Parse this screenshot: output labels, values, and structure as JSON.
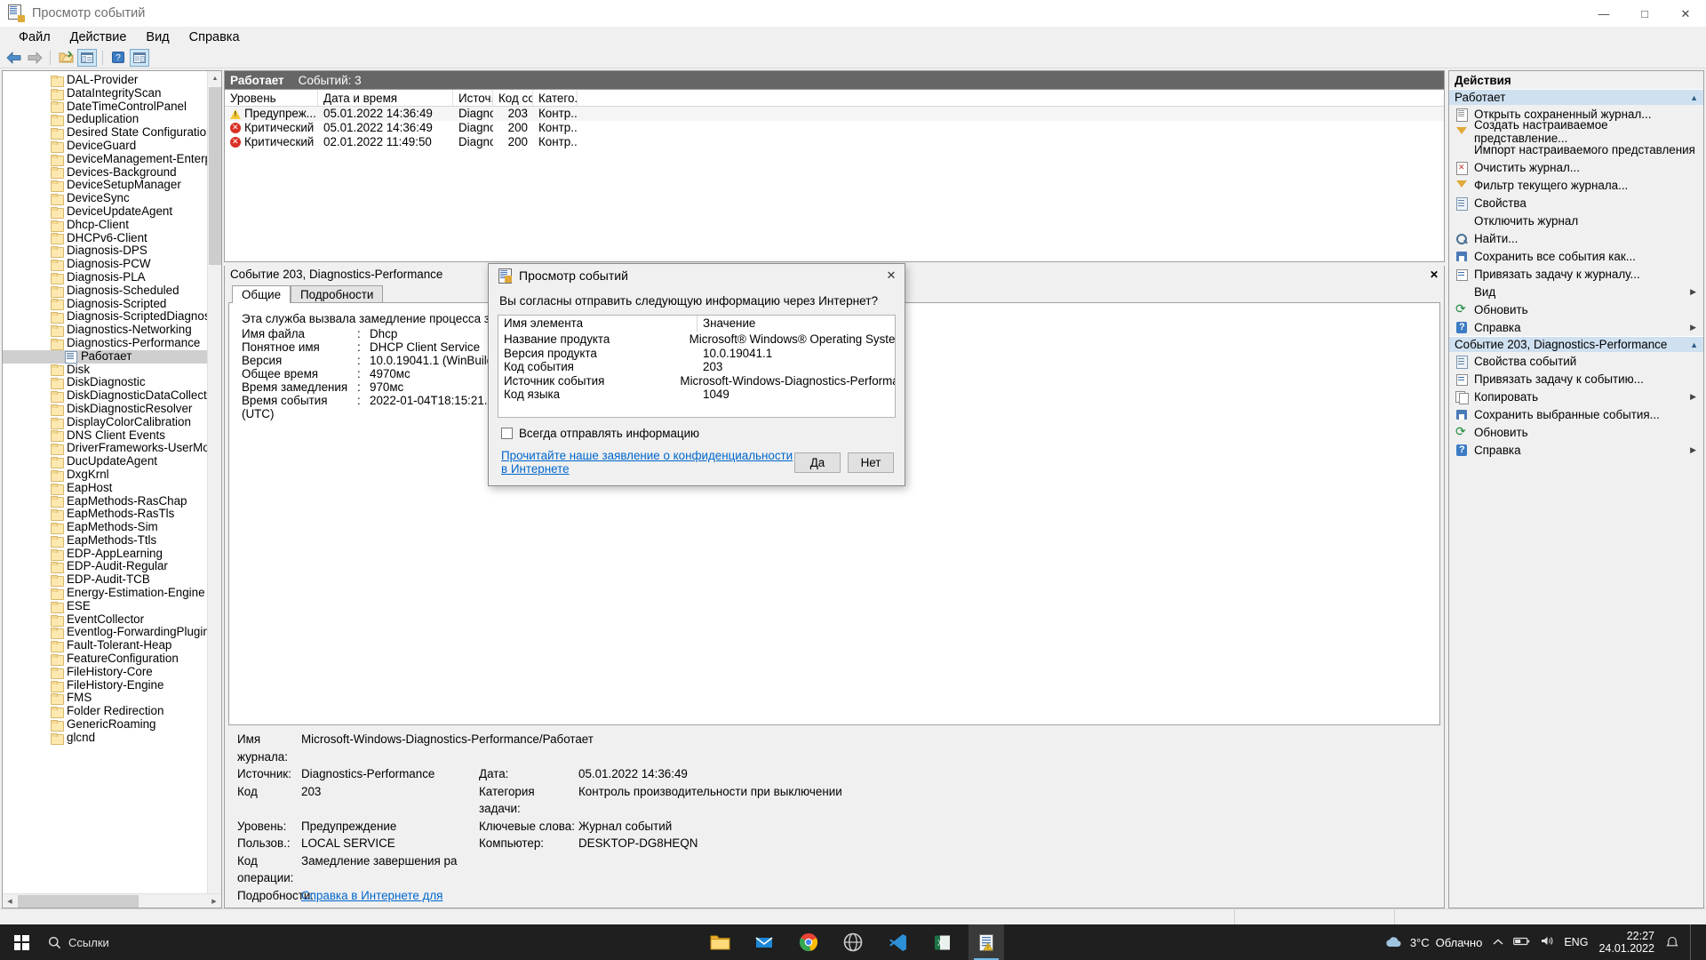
{
  "window": {
    "title": "Просмотр событий",
    "icon": "event-viewer-icon",
    "minimize": "—",
    "maximize": "□",
    "close": "✕"
  },
  "menu": [
    "Файл",
    "Действие",
    "Вид",
    "Справка"
  ],
  "toolbar": [
    {
      "name": "back-icon",
      "glyph": "⬅"
    },
    {
      "name": "forward-icon",
      "glyph": "➡"
    },
    {
      "name": "open-folder-icon",
      "glyph": "📂"
    },
    {
      "name": "show-hide-tree-icon",
      "glyph": "▤"
    },
    {
      "name": "help-icon",
      "glyph": "?"
    },
    {
      "name": "show-action-pane-icon",
      "glyph": "▥"
    }
  ],
  "tree": {
    "items": [
      {
        "label": "DAL-Provider",
        "level": 1,
        "type": "folder",
        "expandable": true
      },
      {
        "label": "DataIntegrityScan",
        "level": 1,
        "type": "folder",
        "expandable": true
      },
      {
        "label": "DateTimeControlPanel",
        "level": 1,
        "type": "folder",
        "expandable": true
      },
      {
        "label": "Deduplication",
        "level": 1,
        "type": "folder",
        "expandable": true
      },
      {
        "label": "Desired State Configuration",
        "level": 1,
        "type": "folder",
        "expandable": true
      },
      {
        "label": "DeviceGuard",
        "level": 1,
        "type": "folder",
        "expandable": true
      },
      {
        "label": "DeviceManagement-Enterprise-D",
        "level": 1,
        "type": "folder",
        "expandable": true
      },
      {
        "label": "Devices-Background",
        "level": 1,
        "type": "folder",
        "expandable": true
      },
      {
        "label": "DeviceSetupManager",
        "level": 1,
        "type": "folder",
        "expandable": true
      },
      {
        "label": "DeviceSync",
        "level": 1,
        "type": "folder",
        "expandable": true
      },
      {
        "label": "DeviceUpdateAgent",
        "level": 1,
        "type": "folder",
        "expandable": true
      },
      {
        "label": "Dhcp-Client",
        "level": 1,
        "type": "folder",
        "expandable": true
      },
      {
        "label": "DHCPv6-Client",
        "level": 1,
        "type": "folder",
        "expandable": true
      },
      {
        "label": "Diagnosis-DPS",
        "level": 1,
        "type": "folder",
        "expandable": true
      },
      {
        "label": "Diagnosis-PCW",
        "level": 1,
        "type": "folder",
        "expandable": true
      },
      {
        "label": "Diagnosis-PLA",
        "level": 1,
        "type": "folder",
        "expandable": true
      },
      {
        "label": "Diagnosis-Scheduled",
        "level": 1,
        "type": "folder",
        "expandable": true
      },
      {
        "label": "Diagnosis-Scripted",
        "level": 1,
        "type": "folder",
        "expandable": true
      },
      {
        "label": "Diagnosis-ScriptedDiagnosticsPro",
        "level": 1,
        "type": "folder",
        "expandable": true
      },
      {
        "label": "Diagnostics-Networking",
        "level": 1,
        "type": "folder",
        "expandable": true
      },
      {
        "label": "Diagnostics-Performance",
        "level": 1,
        "type": "folder",
        "expandable": true,
        "expanded": true
      },
      {
        "label": "Работает",
        "level": 2,
        "type": "log",
        "selected": true
      },
      {
        "label": "Disk",
        "level": 1,
        "type": "folder",
        "expandable": true
      },
      {
        "label": "DiskDiagnostic",
        "level": 1,
        "type": "folder",
        "expandable": true
      },
      {
        "label": "DiskDiagnosticDataCollector",
        "level": 1,
        "type": "folder",
        "expandable": true
      },
      {
        "label": "DiskDiagnosticResolver",
        "level": 1,
        "type": "folder",
        "expandable": true
      },
      {
        "label": "DisplayColorCalibration",
        "level": 1,
        "type": "folder",
        "expandable": true
      },
      {
        "label": "DNS Client Events",
        "level": 1,
        "type": "folder",
        "expandable": true
      },
      {
        "label": "DriverFrameworks-UserMode",
        "level": 1,
        "type": "folder",
        "expandable": true
      },
      {
        "label": "DucUpdateAgent",
        "level": 1,
        "type": "folder",
        "expandable": true
      },
      {
        "label": "DxgKrnl",
        "level": 1,
        "type": "folder",
        "expandable": true
      },
      {
        "label": "EapHost",
        "level": 1,
        "type": "folder",
        "expandable": true
      },
      {
        "label": "EapMethods-RasChap",
        "level": 1,
        "type": "folder",
        "expandable": true
      },
      {
        "label": "EapMethods-RasTls",
        "level": 1,
        "type": "folder",
        "expandable": true
      },
      {
        "label": "EapMethods-Sim",
        "level": 1,
        "type": "folder",
        "expandable": true
      },
      {
        "label": "EapMethods-Ttls",
        "level": 1,
        "type": "folder",
        "expandable": true
      },
      {
        "label": "EDP-AppLearning",
        "level": 1,
        "type": "folder",
        "expandable": true
      },
      {
        "label": "EDP-Audit-Regular",
        "level": 1,
        "type": "folder",
        "expandable": true
      },
      {
        "label": "EDP-Audit-TCB",
        "level": 1,
        "type": "folder",
        "expandable": true
      },
      {
        "label": "Energy-Estimation-Engine",
        "level": 1,
        "type": "folder",
        "expandable": true
      },
      {
        "label": "ESE",
        "level": 1,
        "type": "folder",
        "expandable": true
      },
      {
        "label": "EventCollector",
        "level": 1,
        "type": "folder",
        "expandable": true
      },
      {
        "label": "Eventlog-ForwardingPlugin",
        "level": 1,
        "type": "folder",
        "expandable": true
      },
      {
        "label": "Fault-Tolerant-Heap",
        "level": 1,
        "type": "folder",
        "expandable": true
      },
      {
        "label": "FeatureConfiguration",
        "level": 1,
        "type": "folder",
        "expandable": true
      },
      {
        "label": "FileHistory-Core",
        "level": 1,
        "type": "folder",
        "expandable": true
      },
      {
        "label": "FileHistory-Engine",
        "level": 1,
        "type": "folder",
        "expandable": true
      },
      {
        "label": "FMS",
        "level": 1,
        "type": "folder",
        "expandable": true
      },
      {
        "label": "Folder Redirection",
        "level": 1,
        "type": "folder",
        "expandable": true
      },
      {
        "label": "GenericRoaming",
        "level": 1,
        "type": "folder",
        "expandable": true
      },
      {
        "label": "glcnd",
        "level": 1,
        "type": "folder",
        "expandable": true
      }
    ]
  },
  "event_list": {
    "header_title": "Работает",
    "header_count": "Событий: 3",
    "columns": [
      "Уровень",
      "Дата и время",
      "Источ...",
      "Код со...",
      "Катего..."
    ],
    "rows": [
      {
        "level": "Предупреж...",
        "level_icon": "warning-icon",
        "datetime": "05.01.2022 14:36:49",
        "source": "Diagno...",
        "event_id": "203",
        "category": "Контр..."
      },
      {
        "level": "Критический",
        "level_icon": "critical-icon",
        "datetime": "05.01.2022 14:36:49",
        "source": "Diagno...",
        "event_id": "200",
        "category": "Контр..."
      },
      {
        "level": "Критический",
        "level_icon": "critical-icon",
        "datetime": "02.01.2022 11:49:50",
        "source": "Diagno...",
        "event_id": "200",
        "category": "Контр..."
      }
    ]
  },
  "detail": {
    "title": "Событие 203, Diagnostics-Performance",
    "tabs": [
      {
        "label": "Общие",
        "active": true
      },
      {
        "label": "Подробности",
        "active": false
      }
    ],
    "message": "Эта служба вызвала замедление процесса завершения работ",
    "fields": [
      {
        "key": "Имя файла",
        "sep": ":",
        "value": "Dhcp"
      },
      {
        "key": "Понятное имя",
        "sep": ":",
        "value": "DHCP Client Service"
      },
      {
        "key": "Версия",
        "sep": ":",
        "value": "10.0.19041.1 (WinBuild.1601"
      },
      {
        "key": "Общее время",
        "sep": ":",
        "value": "4970мс"
      },
      {
        "key": "Время замедления",
        "sep": ":",
        "value": "970мс"
      },
      {
        "key": "Время события (UTC)",
        "sep": ":",
        "value": "2022-01-04T18:15:21.601857"
      }
    ],
    "footer": [
      {
        "l1": "Имя журнала:",
        "v1": "Microsoft-Windows-Diagnostics-Performance/Работает",
        "l2": "",
        "v2": ""
      },
      {
        "l1": "Источник:",
        "v1": "Diagnostics-Performance",
        "l2": "Дата:",
        "v2": "05.01.2022 14:36:49"
      },
      {
        "l1": "Код",
        "v1": "203",
        "l2": "Категория задачи:",
        "v2": "Контроль производительности при выключении"
      },
      {
        "l1": "Уровень:",
        "v1": "Предупреждение",
        "l2": "Ключевые слова:",
        "v2": "Журнал событий"
      },
      {
        "l1": "Пользов.:",
        "v1": "LOCAL SERVICE",
        "l2": "Компьютер:",
        "v2": "DESKTOP-DG8HEQN"
      },
      {
        "l1": "Код операции:",
        "v1": "Замедление завершения ра",
        "l2": "",
        "v2": ""
      },
      {
        "l1": "Подробности:",
        "v1": "Справка в Интернете для",
        "l2": "",
        "v2": "",
        "link": true
      }
    ],
    "close_label": "✕"
  },
  "actions": {
    "title": "Действия",
    "groups": [
      {
        "label": "Работает",
        "items": [
          {
            "label": "Открыть сохраненный журнал...",
            "icon": "open-log-icon",
            "submenu": false
          },
          {
            "label": "Создать настраиваемое представление...",
            "icon": "filter-icon",
            "submenu": false
          },
          {
            "label": "Импорт настраиваемого представления",
            "icon": "blank-icon",
            "submenu": false
          },
          {
            "label": "Очистить журнал...",
            "icon": "clear-log-icon",
            "submenu": false
          },
          {
            "label": "Фильтр текущего журнала...",
            "icon": "filter-icon",
            "submenu": false
          },
          {
            "label": "Свойства",
            "icon": "properties-icon",
            "submenu": false
          },
          {
            "label": "Отключить журнал",
            "icon": "blank-icon",
            "submenu": false
          },
          {
            "label": "Найти...",
            "icon": "find-icon",
            "submenu": false
          },
          {
            "label": "Сохранить все события как...",
            "icon": "save-icon",
            "submenu": false
          },
          {
            "label": "Привязать задачу к журналу...",
            "icon": "task-icon",
            "submenu": false
          },
          {
            "label": "Вид",
            "icon": "blank-icon",
            "submenu": true
          },
          {
            "label": "Обновить",
            "icon": "refresh-icon",
            "submenu": false
          },
          {
            "label": "Справка",
            "icon": "help-icon",
            "submenu": true
          }
        ]
      },
      {
        "label": "Событие 203, Diagnostics-Performance",
        "items": [
          {
            "label": "Свойства событий",
            "icon": "properties-icon",
            "submenu": false
          },
          {
            "label": "Привязать задачу к событию...",
            "icon": "task-icon",
            "submenu": false
          },
          {
            "label": "Копировать",
            "icon": "copy-icon",
            "submenu": true
          },
          {
            "label": "Сохранить выбранные события...",
            "icon": "save-icon",
            "submenu": false
          },
          {
            "label": "Обновить",
            "icon": "refresh-icon",
            "submenu": false
          },
          {
            "label": "Справка",
            "icon": "help-icon",
            "submenu": true
          }
        ]
      }
    ]
  },
  "dialog": {
    "title": "Просмотр событий",
    "icon": "event-viewer-icon",
    "close": "✕",
    "question": "Вы согласны отправить следующую информацию через Интернет?",
    "table": {
      "columns": [
        "Имя элемента",
        "Значение"
      ],
      "rows": [
        {
          "name": "Название продукта",
          "value": "Microsoft® Windows® Operating System"
        },
        {
          "name": "Версия продукта",
          "value": "10.0.19041.1"
        },
        {
          "name": "Код события",
          "value": "203"
        },
        {
          "name": "Источник события",
          "value": "Microsoft-Windows-Diagnostics-Performance"
        },
        {
          "name": "Код языка",
          "value": "1049"
        }
      ]
    },
    "checkbox_label": "Всегда отправлять информацию",
    "checkbox_checked": false,
    "privacy_link": "Прочитайте наше заявление о конфиденциальности в Интернете",
    "buttons": [
      {
        "label": "Да",
        "name": "yes-button"
      },
      {
        "label": "Нет",
        "name": "no-button"
      }
    ]
  },
  "taskbar": {
    "start_icon": "windows-start-icon",
    "search_label": "Ссылки",
    "apps": [
      {
        "name": "file-explorer-icon"
      },
      {
        "name": "mail-icon"
      },
      {
        "name": "chrome-icon"
      },
      {
        "name": "browser-icon"
      },
      {
        "name": "vscode-icon"
      },
      {
        "name": "excel-icon"
      },
      {
        "name": "event-viewer-icon",
        "active": true
      }
    ],
    "weather_temp": "3°C",
    "weather_text": "Облачно",
    "language": "ENG",
    "time": "22:27",
    "date": "24.01.2022"
  }
}
